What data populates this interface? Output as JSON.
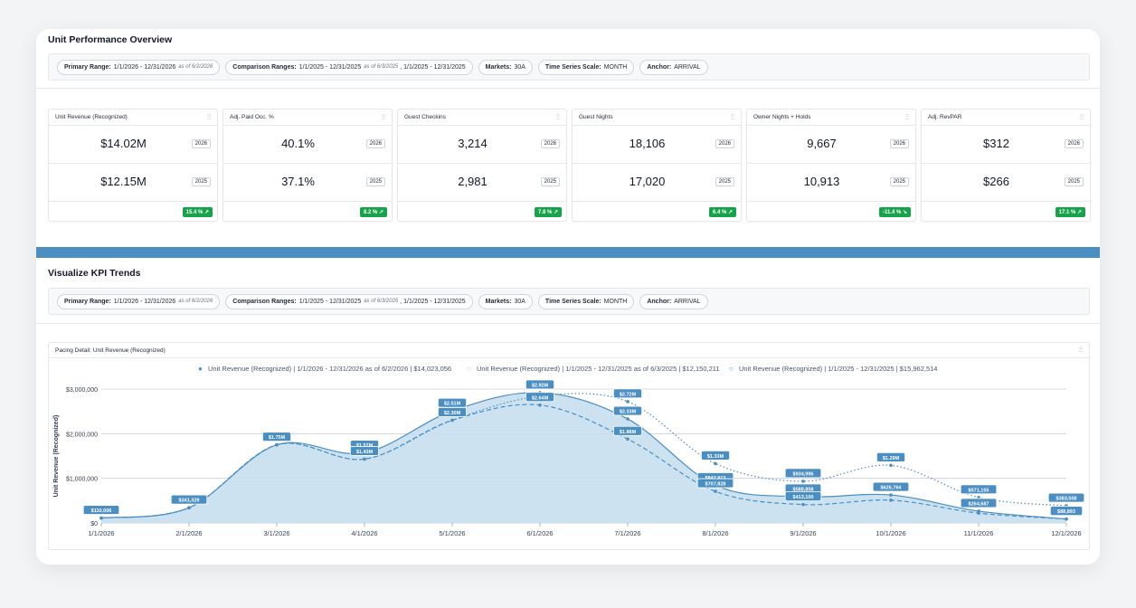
{
  "overview": {
    "title": "Unit Performance Overview",
    "filters": [
      {
        "label": "Primary Range:",
        "value": "1/1/2026 - 12/31/2026",
        "note": "as of 6/2/2026"
      },
      {
        "label": "Comparison Ranges:",
        "value": "1/1/2025 - 12/31/2025",
        "note": "as of 6/3/2025",
        "extra": ", 1/1/2025 - 12/31/2025"
      },
      {
        "label": "Markets:",
        "value": "30A"
      },
      {
        "label": "Time Series Scale:",
        "value": "MONTH"
      },
      {
        "label": "Anchor:",
        "value": "ARRIVAL"
      }
    ]
  },
  "kpis": [
    {
      "title": "Unit Revenue (Recognized)",
      "v2026": "$14.02M",
      "v2025": "$12.15M",
      "change": "15.4 %",
      "dir": "up"
    },
    {
      "title": "Adj. Paid Occ. %",
      "v2026": "40.1%",
      "v2025": "37.1%",
      "change": "8.2 %",
      "dir": "up"
    },
    {
      "title": "Guest Checkins",
      "v2026": "3,214",
      "v2025": "2,981",
      "change": "7.8 %",
      "dir": "up"
    },
    {
      "title": "Guest Nights",
      "v2026": "18,106",
      "v2025": "17,020",
      "change": "6.4 %",
      "dir": "up"
    },
    {
      "title": "Owner Nights + Holds",
      "v2026": "9,667",
      "v2025": "10,913",
      "change": "-11.4 %",
      "dir": "down"
    },
    {
      "title": "Adj. RevPAR",
      "v2026": "$312",
      "v2025": "$266",
      "change": "17.1 %",
      "dir": "up"
    }
  ],
  "year_labels": {
    "current": "2026",
    "prior": "2025"
  },
  "trends": {
    "title": "Visualize KPI Trends",
    "filters": [
      {
        "label": "Primary Range:",
        "value": "1/1/2026 - 12/31/2026",
        "note": "as of 6/2/2026"
      },
      {
        "label": "Comparison Ranges:",
        "value": "1/1/2025 - 12/31/2025",
        "note": "as of 6/3/2025",
        "extra": ", 1/1/2025 - 12/31/2025"
      },
      {
        "label": "Markets:",
        "value": "30A"
      },
      {
        "label": "Time Series Scale:",
        "value": "MONTH"
      },
      {
        "label": "Anchor:",
        "value": "ARRIVAL"
      }
    ],
    "chart_title": "Pacing Detail: Unit Revenue (Recognized)"
  },
  "colors": {
    "accent": "#4a8ec2",
    "positive": "#16a34a",
    "area": "#c6dfee",
    "line": "#4a8ec2"
  },
  "icons": {
    "settings": "sliders-icon",
    "trend_up": "trend-up-icon",
    "trend_down": "trend-down-icon"
  },
  "chart_data": {
    "type": "area",
    "ylabel": "Unit Revenue (Recognized)",
    "yticks": [
      "$0",
      "$1,000,000",
      "$2,000,000",
      "$3,000,000"
    ],
    "ylim": [
      0,
      3000000
    ],
    "categories": [
      "1/1/2026",
      "2/1/2026",
      "3/1/2026",
      "4/1/2026",
      "5/1/2026",
      "6/1/2026",
      "7/1/2026",
      "8/1/2026",
      "9/1/2026",
      "10/1/2026",
      "11/1/2026",
      "12/1/2026"
    ],
    "legend_placement": "top",
    "grid": true,
    "series": [
      {
        "name": "Unit Revenue (Recognized) | 1/1/2026 - 12/31/2026 as of 6/2/2026 | $14,023,056",
        "style": "area",
        "values": [
          110006,
          341329,
          1750000,
          1570000,
          2510000,
          2920000,
          2330000,
          842913,
          588858,
          626764,
          264687,
          88893
        ],
        "labels": [
          "$110,006",
          "$341,329",
          "$1.75M",
          "$1.57M",
          "$2.51M",
          "$2.92M",
          "$2.33M",
          "$842,913",
          "$588,858",
          "$626,764",
          "$264,687",
          "$88,893"
        ]
      },
      {
        "name": "Unit Revenue (Recognized) | 1/1/2025 - 12/31/2025 as of 6/3/2025 | $12,150,211",
        "style": "dashed",
        "values": [
          110006,
          341329,
          1750000,
          1430000,
          2300000,
          2640000,
          1880000,
          707828,
          413100,
          510000,
          220000,
          88893
        ],
        "labels": [
          "",
          "",
          "",
          "$1.43M",
          "$2.30M",
          "$2.64M",
          "$1.88M",
          "$707,828",
          "$413,100",
          "",
          "",
          ""
        ]
      },
      {
        "name": "Unit Revenue (Recognized) | 1/1/2025 - 12/31/2025 | $15,962,514",
        "style": "dotted",
        "values": [
          110006,
          341329,
          1750000,
          1430000,
          2300000,
          2840000,
          2720000,
          1330000,
          934996,
          1290000,
          571155,
          383508
        ],
        "labels": [
          "",
          "",
          "",
          "",
          "",
          "",
          "$2.72M",
          "$1.33M",
          "$934,996",
          "$1.29M",
          "$571,155",
          "$383,508"
        ]
      }
    ]
  }
}
